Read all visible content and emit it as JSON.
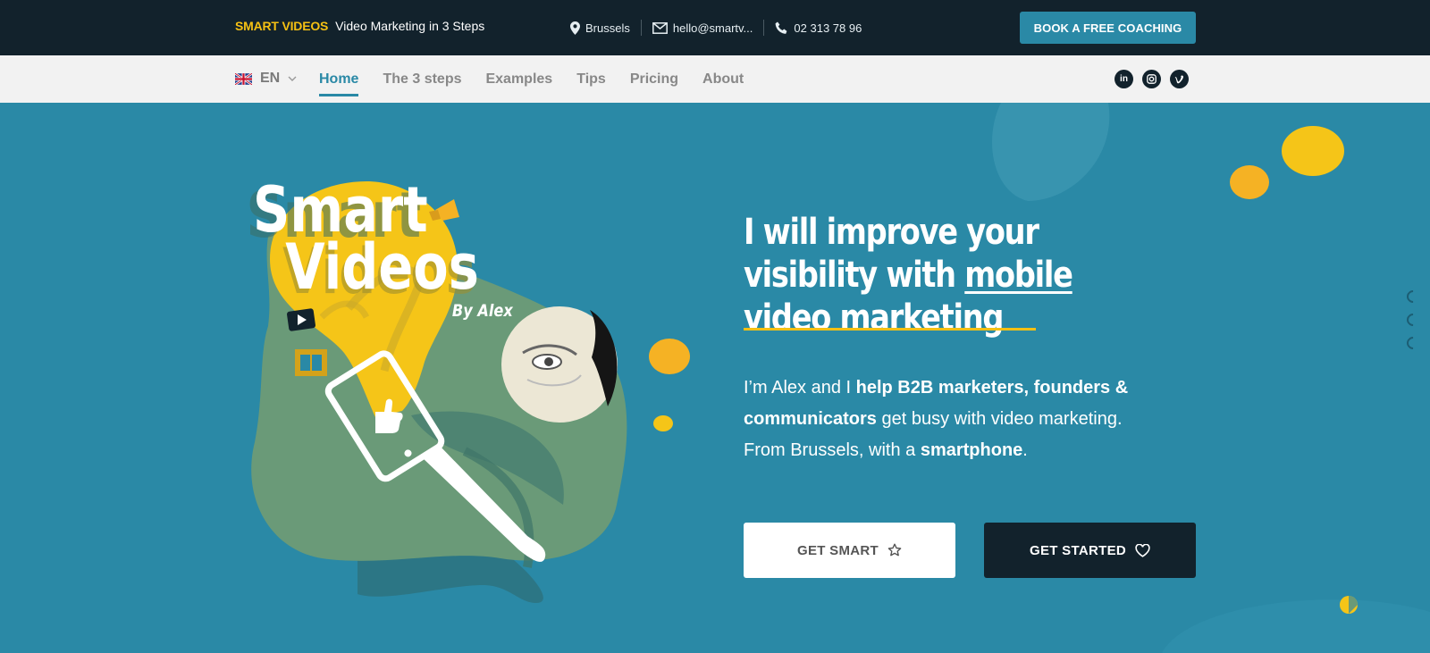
{
  "topbar": {
    "brand_name": "SMART VIDEOS",
    "brand_tagline": "Video Marketing in 3 Steps",
    "location": "Brussels",
    "email": "hello@smartv...",
    "phone": "02 313 78 96",
    "book_button": "BOOK A FREE COACHING"
  },
  "nav": {
    "language": "EN",
    "items": [
      "Home",
      "The 3 steps",
      "Examples",
      "Tips",
      "Pricing",
      "About"
    ],
    "active": "Home",
    "socials": [
      "linkedin-icon",
      "instagram-icon",
      "vimeo-icon"
    ]
  },
  "hero": {
    "logo_line1": "Smart",
    "logo_line2": "Videos",
    "logo_byline": "By Alex",
    "headline_part1": "I will improve your visibility with ",
    "headline_underlined": "mobile",
    "headline_part2": " video marketing",
    "intro_1": "I’m Alex and I ",
    "intro_bold_1": "help B2B marketers, founders & communicators",
    "intro_2": " get busy with video marketing.",
    "intro_3": "From Brussels, with a ",
    "intro_bold_2": "smartphone",
    "intro_4": ".",
    "btn_smart": "GET SMART",
    "btn_start": "GET STARTED"
  },
  "colors": {
    "hero_bg": "#2a89a6",
    "dark": "#12222c",
    "accent_yellow": "#f5c013",
    "nav_bg": "#f2f2f2",
    "blob_green": "#6a9a78"
  }
}
